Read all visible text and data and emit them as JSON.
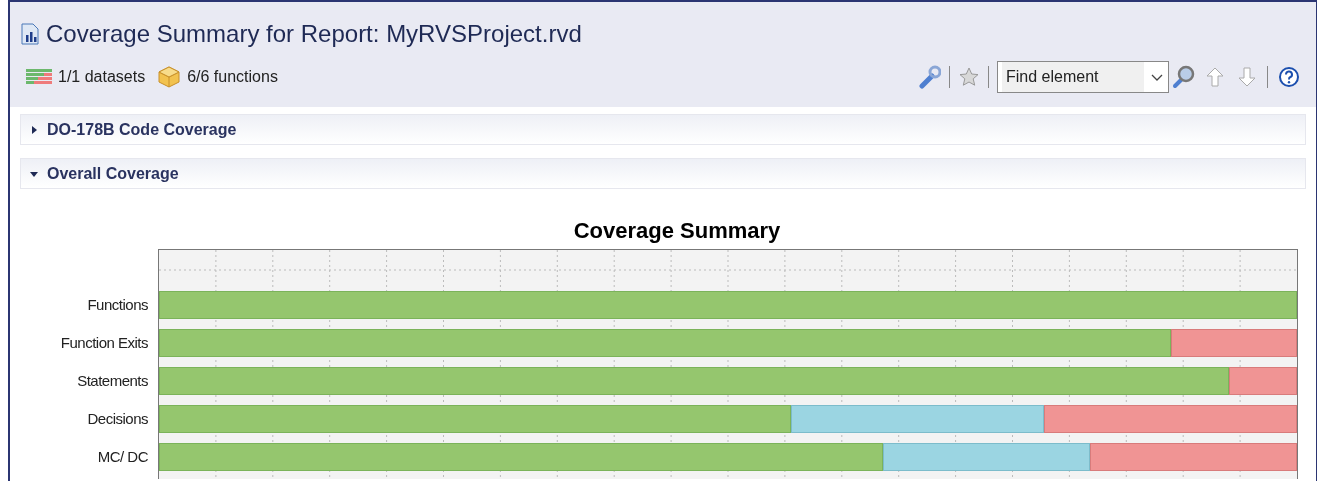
{
  "header": {
    "title": "Coverage Summary for Report: MyRVSProject.rvd",
    "datasets": "1/1 datasets",
    "functions": "6/6 functions",
    "find": {
      "value": "Find element"
    }
  },
  "sections": [
    {
      "label": "DO-178B Code Coverage",
      "expanded": false
    },
    {
      "label": "Overall Coverage",
      "expanded": true
    }
  ],
  "chart": {
    "title": "Coverage Summary",
    "rows": [
      {
        "label": "Functions"
      },
      {
        "label": "Function Exits"
      },
      {
        "label": "Statements"
      },
      {
        "label": "Decisions"
      },
      {
        "label": "MC/ DC"
      }
    ]
  }
}
